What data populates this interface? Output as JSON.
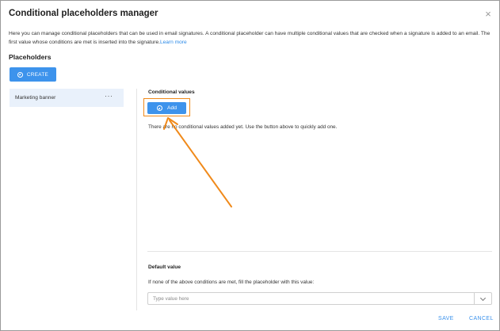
{
  "dialog": {
    "title": "Conditional placeholders manager",
    "close_glyph": "×",
    "description": "Here you can manage conditional placeholders that can be used in email signatures. A conditional placeholder can have multiple conditional values that are checked when a signature is added to an email. The first value whose conditions are met is inserted into the signature.",
    "learn_more": "Learn more"
  },
  "placeholders": {
    "section_title": "Placeholders",
    "create_label": "CREATE",
    "items": [
      {
        "label": "Marketing banner",
        "menu_glyph": "···"
      }
    ]
  },
  "conditional_values": {
    "title": "Conditional values",
    "add_label": "Add",
    "empty_message": "There are no conditional values added yet. Use the button above to quickly add one."
  },
  "default_value": {
    "title": "Default value",
    "description": "If none of the above conditions are met, fill the placeholder with this value:",
    "input_value": "",
    "input_placeholder": "Type value here"
  },
  "footer": {
    "save_label": "SAVE",
    "cancel_label": "CANCEL"
  },
  "colors": {
    "accent": "#3d93ec",
    "highlight": "#f08a1b",
    "selected_item_bg": "#e9f1fb"
  },
  "icons": {
    "close": "close-icon",
    "create": "plus-circle-icon",
    "add": "plus-circle-icon",
    "item_menu": "more-horizontal-icon",
    "dropdown": "chevron-down-icon"
  }
}
